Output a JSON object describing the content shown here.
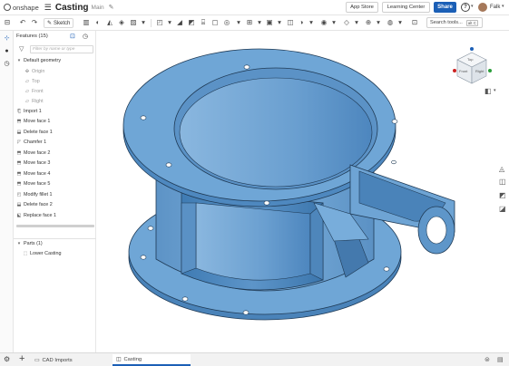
{
  "header": {
    "logo_text": "onshape",
    "doc_title": "Casting",
    "workspace": "Main",
    "app_store": "App Store",
    "learning_center": "Learning Center",
    "share": "Share",
    "user": "Falk",
    "help_icon": "?"
  },
  "toolbar": {
    "sketch_label": "Sketch",
    "search_placeholder": "Search tools...",
    "search_shortcut": "alt C"
  },
  "features": {
    "header": "Features (15)",
    "filter_placeholder": "Filter by name or type",
    "default_geometry": "Default geometry",
    "geometry_items": [
      "Origin",
      "Top",
      "Front",
      "Right"
    ],
    "items": [
      "Import 1",
      "Move face 1",
      "Delete face 1",
      "Chamfer 1",
      "Move face 2",
      "Move face 3",
      "Move face 4",
      "Move face 5",
      "Modify fillet 1",
      "Delete face 2",
      "Replace face 1"
    ],
    "parts_header": "Parts (1)",
    "parts": [
      "Lower Casting"
    ]
  },
  "viewcube": {
    "top": "Top",
    "front": "Front",
    "right": "Right"
  },
  "tabs": {
    "folder": "CAD Imports",
    "part_studio": "Casting"
  },
  "colors": {
    "accent": "#1b5fb6",
    "part_color": "#6fa6d6"
  }
}
